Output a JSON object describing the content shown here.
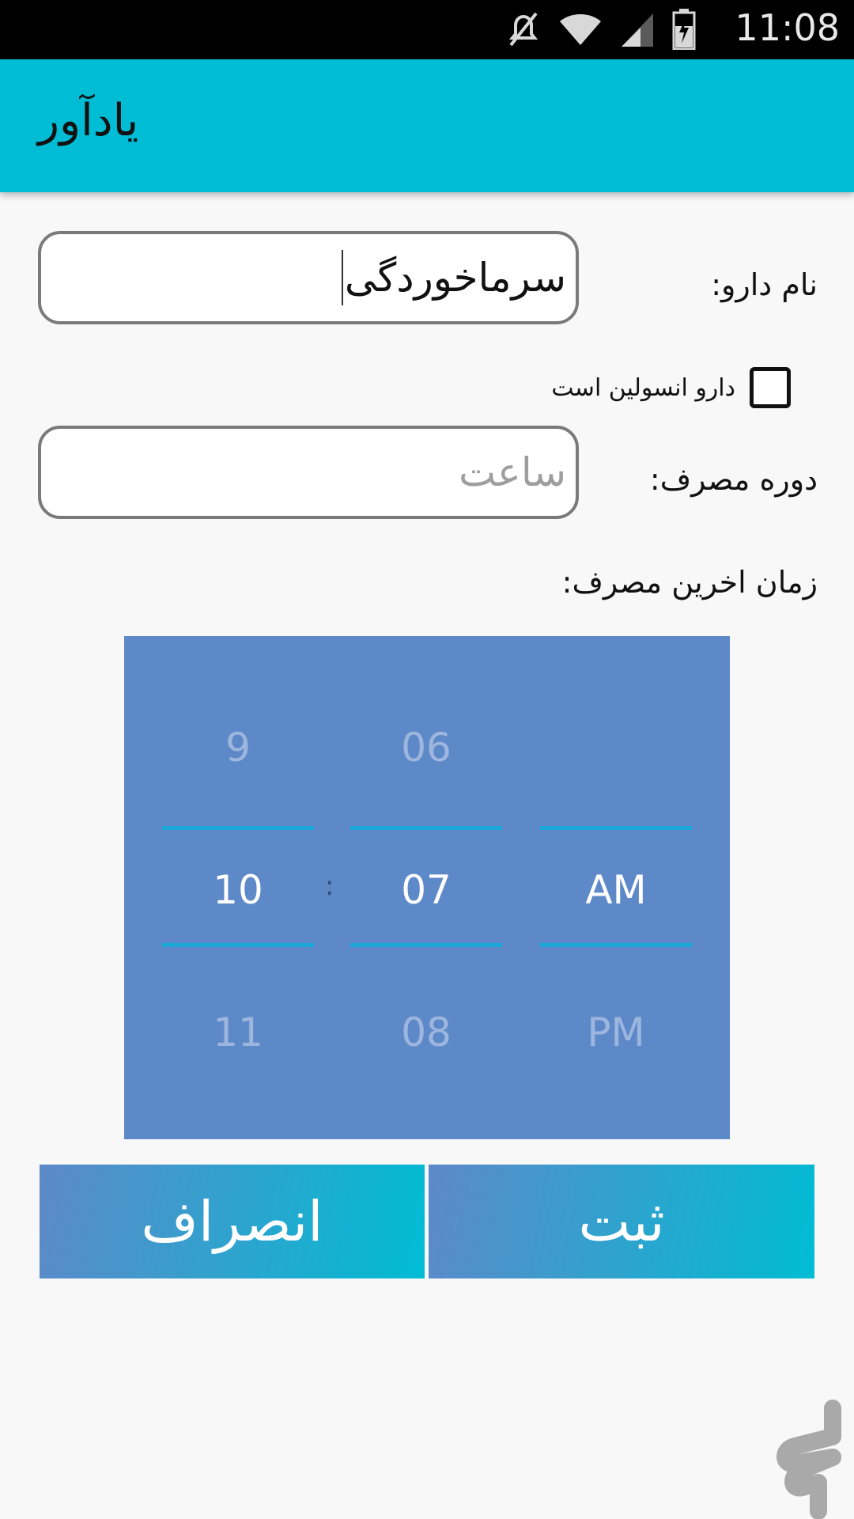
{
  "status_bar": {
    "time": "11:08",
    "icons": [
      "mute-icon",
      "wifi-icon",
      "signal-icon",
      "battery-icon"
    ]
  },
  "app_bar": {
    "title": "یادآور"
  },
  "form": {
    "drug_name_label": "نام دارو:",
    "drug_name_value": "سرماخوردگی",
    "insulin_checkbox_label": "دارو انسولین است",
    "insulin_checked": false,
    "period_label": "دوره مصرف:",
    "period_placeholder": "ساعت",
    "last_time_label": "زمان اخرین مصرف:"
  },
  "time_picker": {
    "hour": {
      "prev": "9",
      "current": "10",
      "next": "11"
    },
    "separator": ":",
    "minute": {
      "prev": "06",
      "current": "07",
      "next": "08"
    },
    "ampm": {
      "prev": "",
      "current": "AM",
      "next": "PM"
    }
  },
  "buttons": {
    "cancel": "انصراف",
    "submit": "ثبت"
  },
  "colors": {
    "app_bar": "#00bcd4",
    "picker_bg": "#5e89c8",
    "picker_line": "#1aa6d6"
  }
}
